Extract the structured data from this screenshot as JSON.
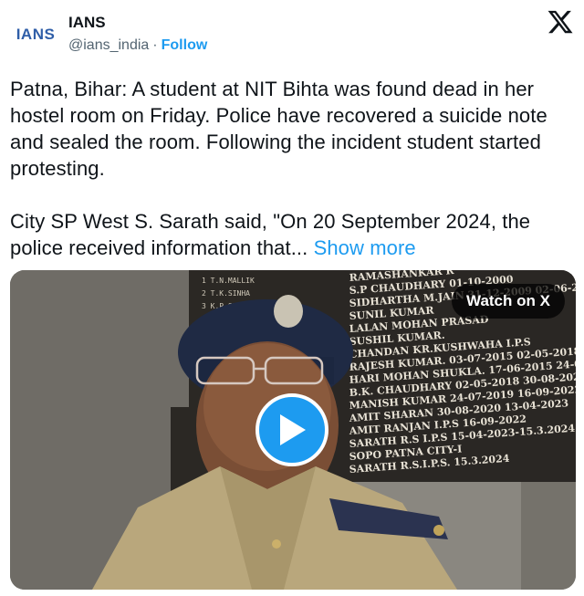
{
  "author": {
    "avatar_text": "IANS",
    "name": "IANS",
    "handle": "@ians_india",
    "separator": "·",
    "follow_label": "Follow"
  },
  "platform_icon": "x-logo-icon",
  "tweet": {
    "paragraph_1": "Patna, Bihar: A student at NIT Bihta was found dead in her hostel room on Friday. Police have recovered a suicide note and sealed the room. Following the incident student started protesting.",
    "paragraph_2": "City SP West S. Sarath said, \"On 20 September 2024, the police received information that...",
    "show_more_label": "Show more"
  },
  "media": {
    "watch_label": "Watch on X",
    "play_icon": "play-icon",
    "board_lines": [
      "RAMASHANKAR R",
      "S.P CHAUDHARY   01-10-2000",
      "SIDHARTHA M.JAIN   31-12-2009  02-06-2011",
      "SUNIL KUMAR",
      "LALAN MOHAN PRASAD",
      "SUSHIL KUMAR.",
      "CHANDAN KR.KUSHWAHA I.P.S",
      "RAJESH KUMAR.   03-07-2015  02-05-2018",
      "HARI MOHAN SHUKLA.   17-06-2015  24-07-2019",
      "B.K. CHAUDHARY   02-05-2018  30-08-2020",
      "MANISH KUMAR 24-07-2019  16-09-2022",
      "AMIT SHARAN 30-08-2020  13-04-2023",
      "AMIT RANJAN  I.P.S 16-09-2022",
      "SARATH R.S I.P.S 15-04-2023-15.3.2024",
      "SOPO PATNA CITY-I",
      "SARATH R.S.I.P.S. 15.3.2024"
    ]
  },
  "colors": {
    "accent": "#1d9bf0",
    "text": "#0f1419",
    "muted": "#536471",
    "board": "#2a2724",
    "board_text": "#e8e2d5"
  }
}
